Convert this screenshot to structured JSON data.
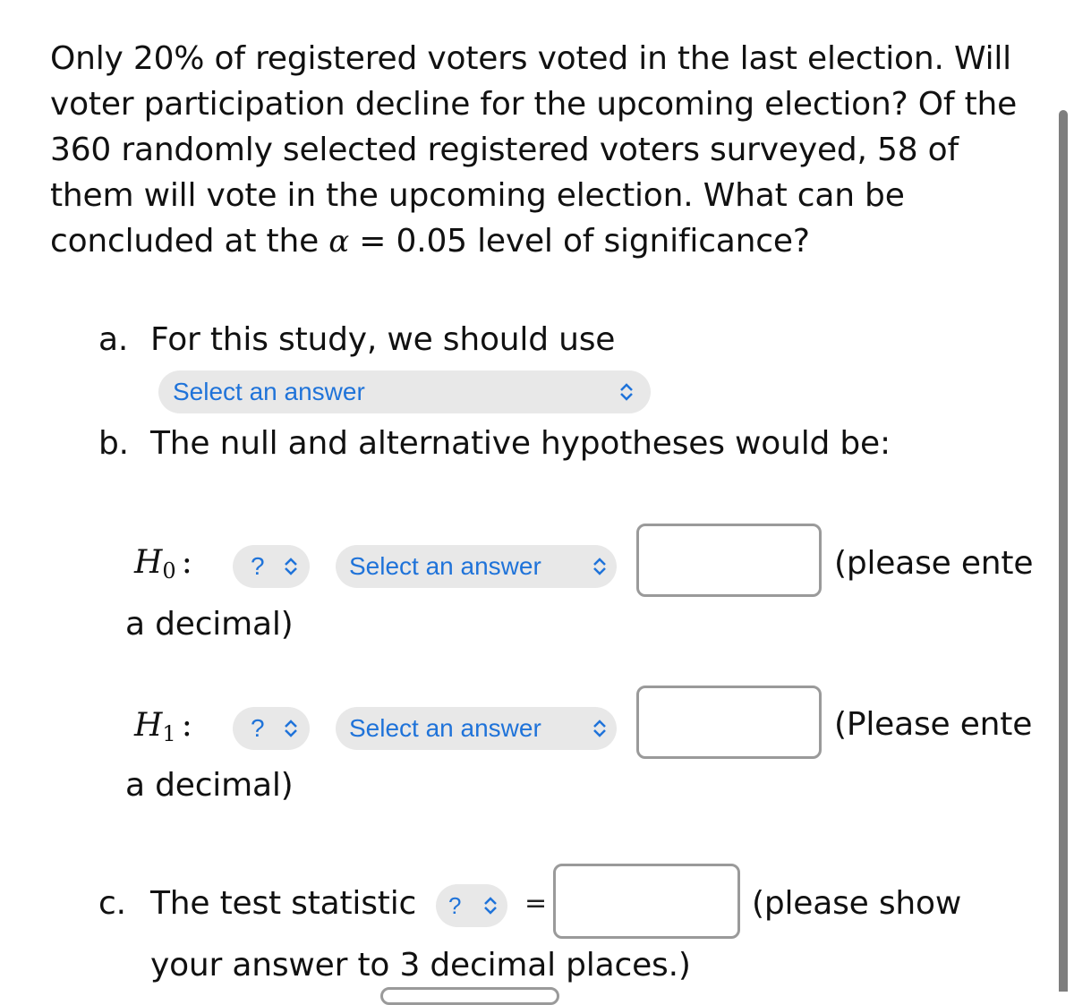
{
  "question": {
    "text_before_alpha": "Only 20% of registered voters voted in the last election. Will voter participation decline for the upcoming election? Of the 360 randomly selected registered voters surveyed, 58 of them will vote in the upcoming election. What can be concluded at the ",
    "alpha_symbol": "α",
    "text_after_alpha": " = 0.05 level of significance?"
  },
  "part_a": {
    "letter": "a.",
    "label": "For this study, we should use",
    "select": {
      "value": "Select an answer",
      "icon": "chevron-up-down-icon"
    }
  },
  "part_b": {
    "letter": "b.",
    "label": "The null and alternative hypotheses would be:",
    "h0": {
      "symbol": "H",
      "subscript": "0",
      "colon": ":",
      "operator_select": "?",
      "param_select": "Select an answer",
      "input_value": "",
      "note_line1": "(please ente",
      "note_line2": "a decimal)"
    },
    "h1": {
      "symbol": "H",
      "subscript": "1",
      "colon": ":",
      "operator_select": "?",
      "param_select": "Select an answer",
      "input_value": "",
      "note_line1": "(Please ente",
      "note_line2": "a decimal)"
    }
  },
  "part_c": {
    "letter": "c.",
    "label": "The test statistic",
    "stat_select": "?",
    "equals": "=",
    "input_value": "",
    "note_line1": "(please show",
    "note_line2": "your answer to 3 decimal places.)"
  },
  "colors": {
    "select_text": "#1f73d9",
    "select_bg": "#e8e8e8",
    "input_border": "#9a9a9a",
    "scrollbar": "#7e7e7e"
  }
}
